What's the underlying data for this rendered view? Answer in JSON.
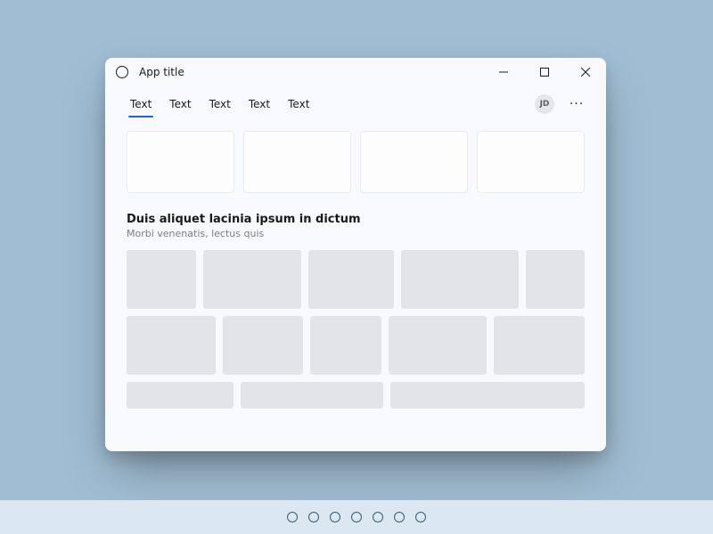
{
  "window": {
    "title": "App title"
  },
  "tabs": [
    {
      "label": "Text",
      "active": true
    },
    {
      "label": "Text",
      "active": false
    },
    {
      "label": "Text",
      "active": false
    },
    {
      "label": "Text",
      "active": false
    },
    {
      "label": "Text",
      "active": false
    }
  ],
  "avatar": {
    "initials": "JD"
  },
  "section": {
    "title": "Duis aliquet lacinia ipsum in dictum",
    "subtitle": "Morbi venenatis, lectus quis"
  },
  "pager": {
    "count": 7
  }
}
